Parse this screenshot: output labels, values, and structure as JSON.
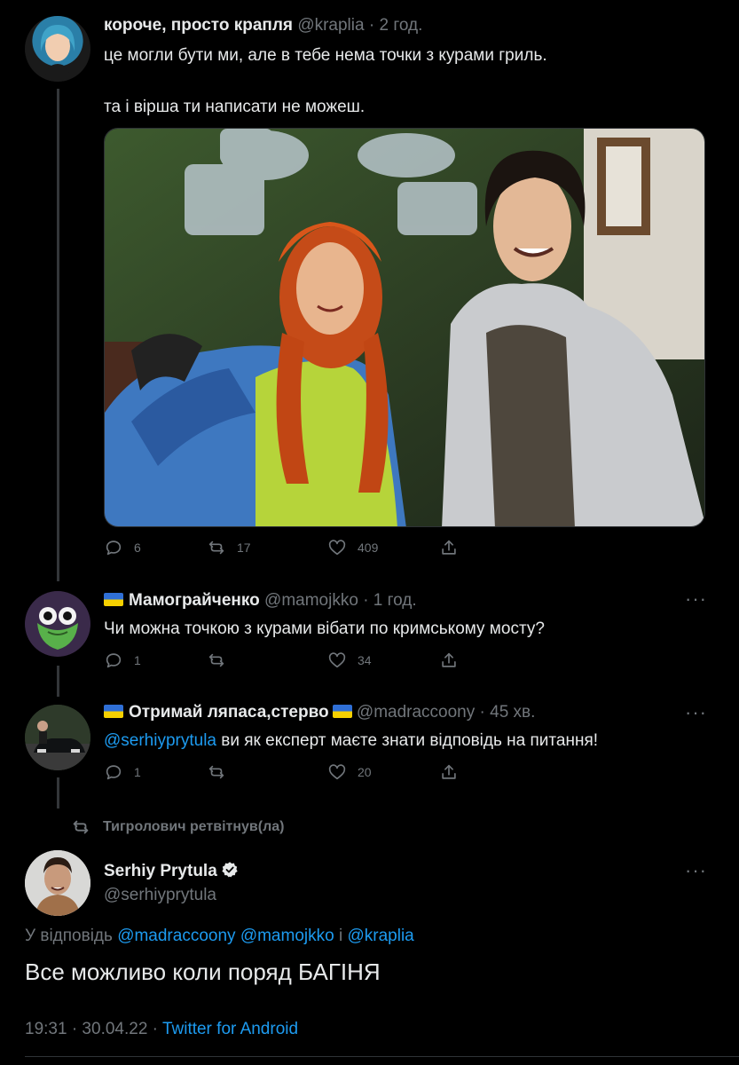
{
  "tweets": [
    {
      "name": "короче, просто крапля",
      "handle": "@kraplia",
      "time": "2 год.",
      "text_line1": "це могли бути ми, але в тебе нема точки з курами гриль.",
      "text_line2": "та і вірша ти написати не можеш.",
      "replies": "6",
      "retweets": "17",
      "likes": "409"
    },
    {
      "name": "Мамограйченко",
      "handle": "@mamojkko",
      "time": "1 год.",
      "text": "Чи можна точкою з курами вібати по кримському мосту?",
      "replies": "1",
      "retweets": "",
      "likes": "34"
    },
    {
      "name": "Отримай ляпаса,стерво",
      "handle": "@madraccoony",
      "time": "45 хв.",
      "mention": "@serhiyprytula",
      "text": " ви як експерт маєте знати відповідь на питання!",
      "replies": "1",
      "retweets": "",
      "likes": "20"
    }
  ],
  "retweeted_by": "Тигролович ретвітнув(ла)",
  "main": {
    "name": "Serhiy Prytula",
    "handle": "@serhiyprytula",
    "reply_prefix": "У відповідь ",
    "reply_mention1": "@madraccoony",
    "reply_mention2": "@mamojkko",
    "reply_and": " і ",
    "reply_mention3": "@kraplia",
    "text": "Все можливо коли поряд БАГІНЯ",
    "timestamp": "19:31 · 30.04.22 · ",
    "source": "Twitter for Android"
  },
  "icons": {
    "reply": "reply-icon",
    "retweet": "retweet-icon",
    "like": "heart-icon",
    "share": "share-icon",
    "more": "more-icon",
    "verified": "verified-badge-icon",
    "flag": "ukraine-flag-icon"
  }
}
